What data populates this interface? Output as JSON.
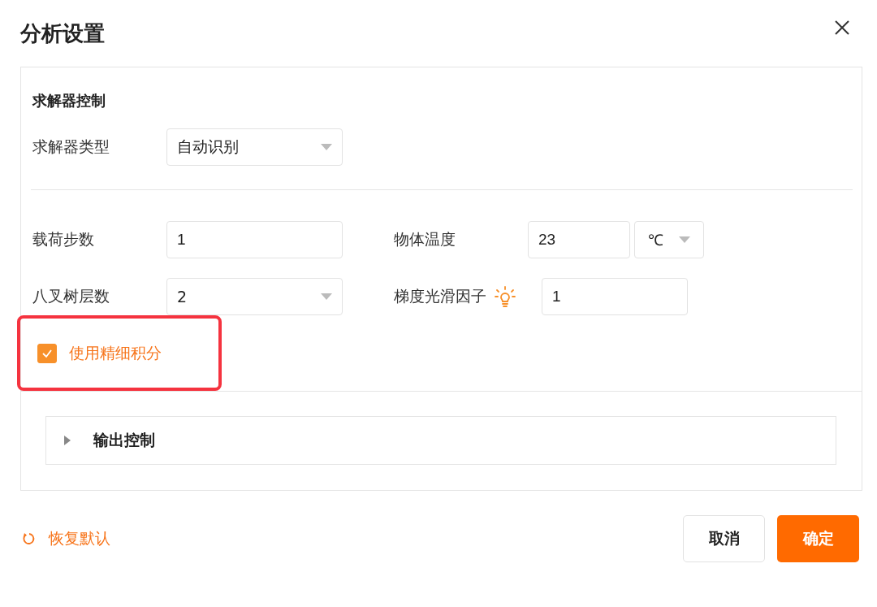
{
  "dialog": {
    "title": "分析设置"
  },
  "solver": {
    "title": "求解器控制",
    "type_field": {
      "label": "求解器类型",
      "value": "自动识别"
    }
  },
  "fields": [
    {
      "kind": "input",
      "label": "载荷步数",
      "value": "1"
    },
    {
      "kind": "input-unit",
      "label": "物体温度",
      "value": "23",
      "unit": "℃"
    },
    {
      "kind": "select",
      "label": "八叉树层数",
      "value": "2"
    },
    {
      "kind": "input-hint",
      "label": "梯度光滑因子",
      "value": "1"
    }
  ],
  "options": [
    {
      "label": "使用精细积分",
      "checked": true,
      "highlighted": true
    }
  ],
  "output_section": {
    "title": "输出控制",
    "expanded": false
  },
  "footer": {
    "reset": "恢复默认",
    "cancel": "取消",
    "confirm": "确定"
  }
}
